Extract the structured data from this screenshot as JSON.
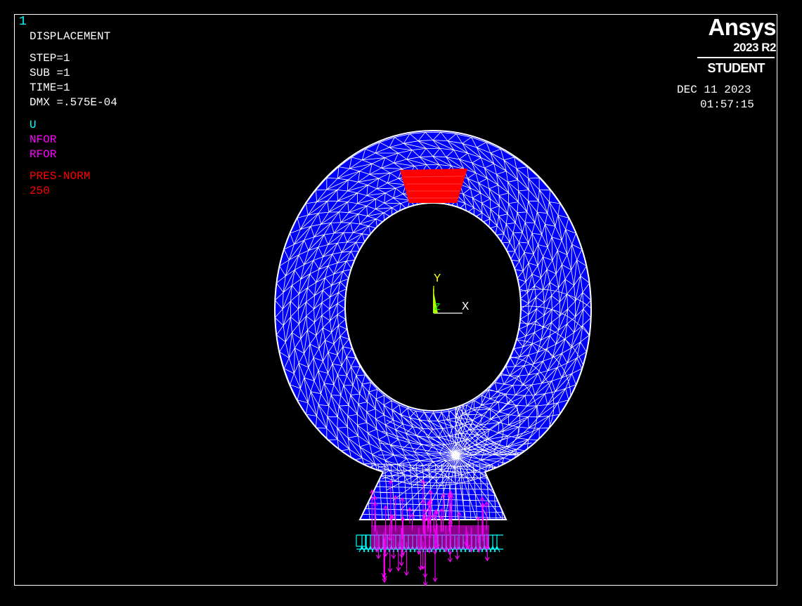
{
  "window_number": "1",
  "result": {
    "title": "DISPLACEMENT",
    "step": "STEP=1",
    "sub": "SUB =1",
    "time": "TIME=1",
    "dmx": "DMX =.575E-04"
  },
  "legend": {
    "u": "U",
    "nfor": "NFOR",
    "rfor": "RFOR",
    "pres_label": "PRES-NORM",
    "pres_value": "250"
  },
  "branding": {
    "product": "Ansys",
    "version": "2023 R2",
    "edition": "STUDENT"
  },
  "timestamp": {
    "date": "DEC 11 2023",
    "time": "01:57:15"
  },
  "triad": {
    "x": "X",
    "y": "Y",
    "z": "Z"
  },
  "colors": {
    "background": "#000000",
    "mesh_fill": "#0000ff",
    "mesh_lines": "#ffffff",
    "pressure": "#ff0000",
    "constraint": "#00ffff",
    "forces": "#ff00ff",
    "triad_y": "#ffff00",
    "triad_z": "#00ff00",
    "label_cyan": "#00ffff",
    "label_magenta": "#ff00ff",
    "label_red": "#ff0000"
  }
}
